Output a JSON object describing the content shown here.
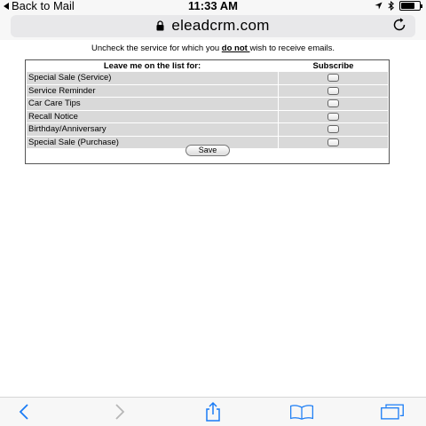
{
  "status_bar": {
    "back_label": "Back to Mail",
    "time": "11:33 AM"
  },
  "address_bar": {
    "url": "eleadcrm.com"
  },
  "page": {
    "instruction_before": "Uncheck the service for which you ",
    "instruction_emphasis": "do not ",
    "instruction_after": "wish to receive emails.",
    "table": {
      "headers": [
        "Leave me on the list for:",
        "Subscribe"
      ],
      "rows": [
        {
          "label": "Special Sale (Service)",
          "checked": false
        },
        {
          "label": "Service Reminder",
          "checked": false
        },
        {
          "label": "Car Care Tips",
          "checked": false
        },
        {
          "label": "Recall Notice",
          "checked": false
        },
        {
          "label": "Birthday/Anniversary",
          "checked": false
        },
        {
          "label": "Special Sale (Purchase)",
          "checked": false
        }
      ]
    },
    "save_label": "Save"
  },
  "toolbar": {
    "icons": [
      "back-icon",
      "forward-icon",
      "share-icon",
      "bookmarks-icon",
      "tabs-icon"
    ],
    "accent_color": "#1a7cf5",
    "disabled_color": "#b7b7b7"
  }
}
